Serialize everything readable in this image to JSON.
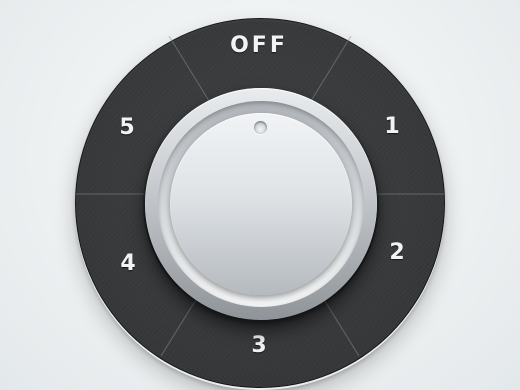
{
  "dial": {
    "positions": {
      "off": "OFF",
      "one": "1",
      "two": "2",
      "three": "3",
      "four": "4",
      "five": "5"
    },
    "selected": "OFF"
  },
  "colors": {
    "background": "#eef1f2",
    "dial_face": "#37393b",
    "label_text": "#f2f3f4",
    "knob_silver": "#dfe3e6"
  }
}
